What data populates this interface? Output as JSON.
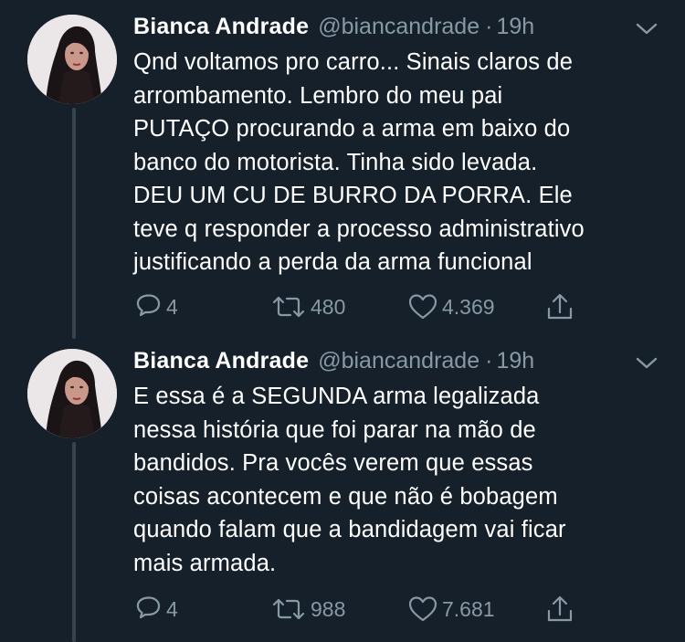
{
  "thread": {
    "tweets": [
      {
        "author": {
          "display_name": "Bianca Andrade",
          "handle": "@biancandrade",
          "avatar_icon": "profile-photo"
        },
        "separator": "·",
        "time": "19h",
        "text": "Qnd voltamos pro carro... Sinais claros de\narrombamento. Lembro do meu pai\nPUTAÇO procurando a arma em baixo do\nbanco do motorista. Tinha sido levada.\nDEU UM CU DE BURRO DA PORRA. Ele\nteve q responder a processo administrativo\njustificando a perda da arma funcional",
        "actions": {
          "reply_count": "4",
          "retweet_count": "480",
          "like_count": "4.369"
        }
      },
      {
        "author": {
          "display_name": "Bianca Andrade",
          "handle": "@biancandrade",
          "avatar_icon": "profile-photo"
        },
        "separator": "·",
        "time": "19h",
        "text": "E essa é a SEGUNDA arma legalizada\nnessa história que foi parar na mão de\nbandidos. Pra vocês verem que essas\ncoisas acontecem e que não é bobagem\nquando falam que a bandidagem vai ficar\nmais armada.",
        "actions": {
          "reply_count": "4",
          "retweet_count": "988",
          "like_count": "7.681"
        }
      }
    ]
  },
  "colors": {
    "background": "#15202b",
    "text_primary": "#ffffff",
    "text_secondary": "#8899a6",
    "thread_line": "#38444d"
  },
  "icons": [
    "chevron-down-icon",
    "reply-icon",
    "retweet-icon",
    "like-icon",
    "share-icon"
  ]
}
